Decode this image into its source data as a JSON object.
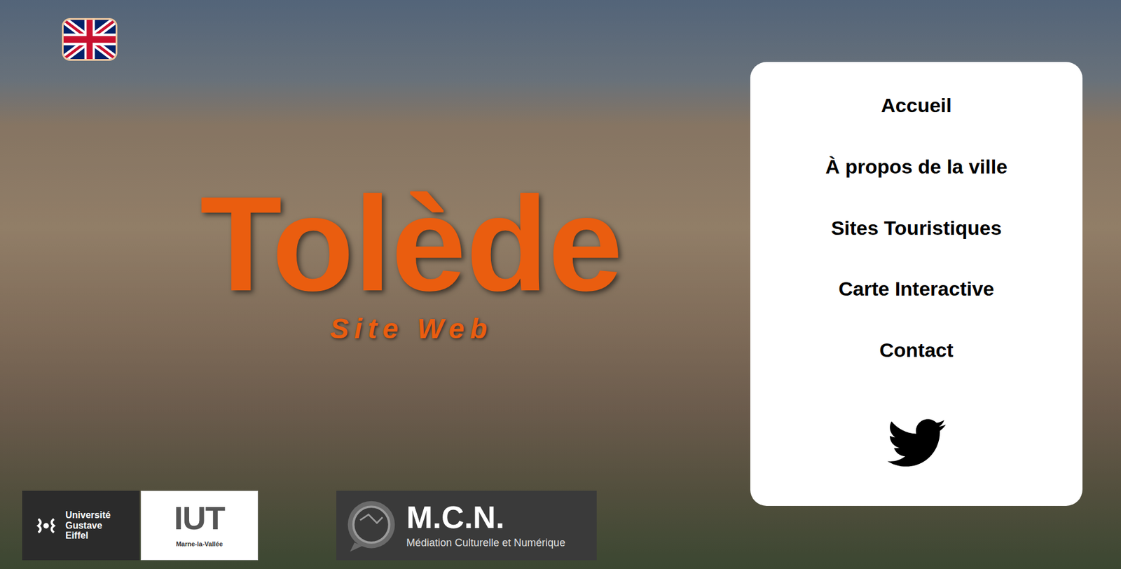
{
  "page": {
    "title": "Tolède",
    "subtitle": "Site Web"
  },
  "language_switch": {
    "language": "en"
  },
  "menu": {
    "items": [
      {
        "label": "Accueil",
        "selected": false
      },
      {
        "label": "À propos de la ville",
        "selected": false
      },
      {
        "label": "Sites Touristiques",
        "selected": false
      },
      {
        "label": "Carte Interactive",
        "selected": false
      },
      {
        "label": "Contact",
        "selected": false
      }
    ],
    "social": [
      "twitter"
    ]
  },
  "logos": {
    "university": {
      "lines": [
        "Université",
        "Gustave",
        "Eiffel"
      ]
    },
    "iut": {
      "name": "IUT",
      "place": "Marne-la-Vallée"
    },
    "mcn": {
      "name": "M.C.N.",
      "full": "Médiation Culturelle et Numérique"
    }
  }
}
